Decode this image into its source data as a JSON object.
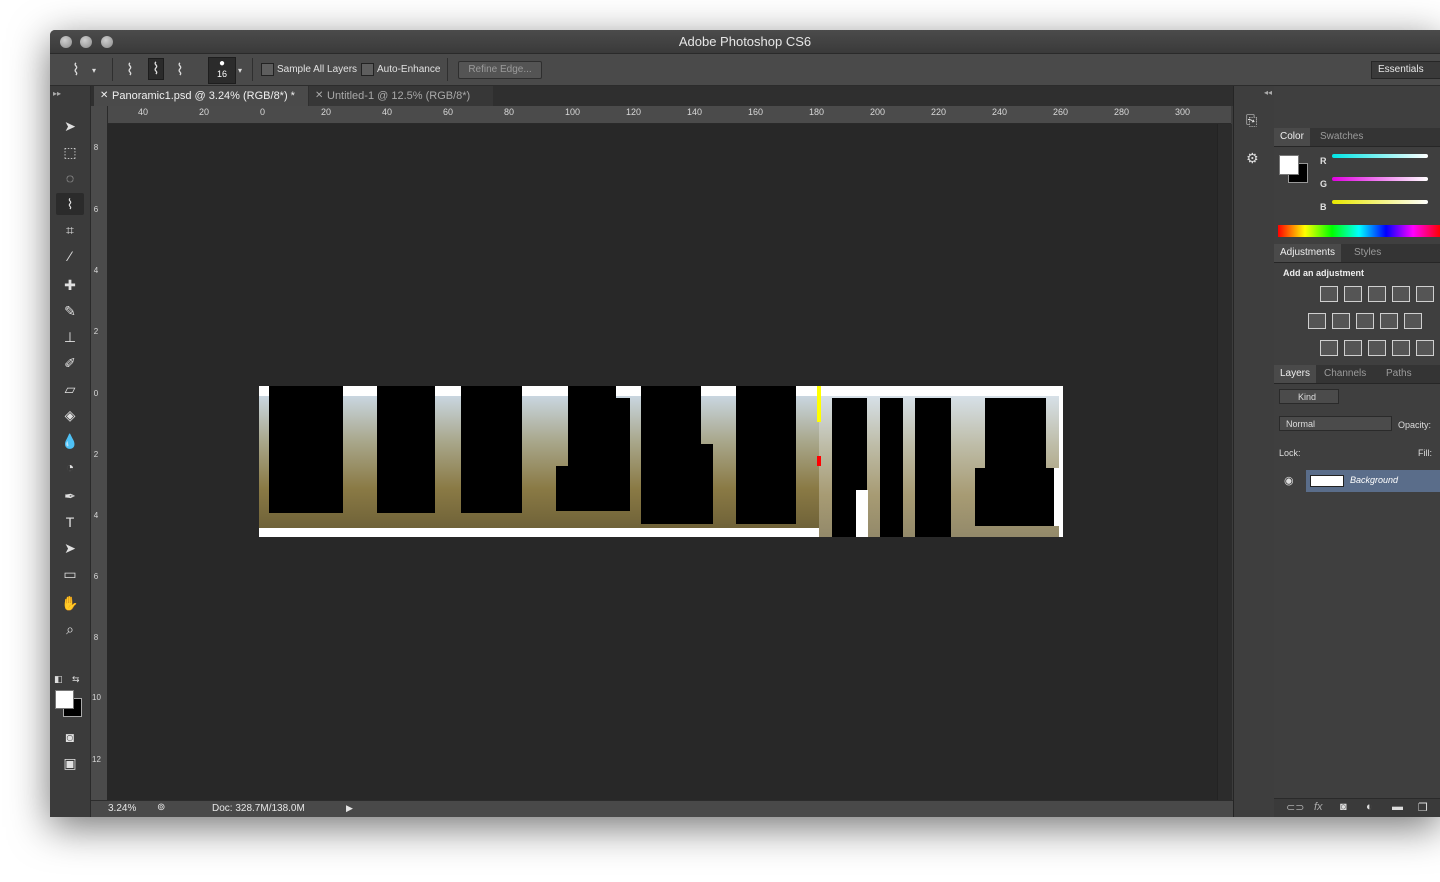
{
  "app": {
    "title": "Adobe Photoshop CS6",
    "workspace": "Essentials"
  },
  "options_bar": {
    "brush_size": "16",
    "sample_all_layers": "Sample All Layers",
    "auto_enhance": "Auto-Enhance",
    "refine_edge": "Refine Edge..."
  },
  "tabs": [
    {
      "label": "Panoramic1.psd @ 3.24% (RGB/8*) *",
      "active": true
    },
    {
      "label": "Untitled-1 @ 12.5% (RGB/8*)",
      "active": false
    }
  ],
  "ruler": {
    "h_labels": [
      "40",
      "20",
      "0",
      "20",
      "40",
      "60",
      "80",
      "100",
      "120",
      "140",
      "160",
      "180",
      "200",
      "220",
      "240",
      "260",
      "280",
      "300"
    ],
    "v_labels": [
      "8",
      "6",
      "4",
      "2",
      "0",
      "2",
      "4",
      "6",
      "8",
      "10",
      "12"
    ]
  },
  "status": {
    "zoom": "3.24%",
    "doc": "Doc: 328.7M/138.0M"
  },
  "color_panel": {
    "tabs": [
      "Color",
      "Swatches"
    ],
    "channels": [
      "R",
      "G",
      "B"
    ],
    "colors": {
      "r": "#00e5e5",
      "g": "#e000e0",
      "b": "#e8e800"
    }
  },
  "adjustments_panel": {
    "tabs": [
      "Adjustments",
      "Styles"
    ],
    "heading": "Add an adjustment"
  },
  "layers_panel": {
    "tabs": [
      "Layers",
      "Channels",
      "Paths"
    ],
    "kind": "Kind",
    "blend_mode": "Normal",
    "opacity_label": "Opacity:",
    "lock_label": "Lock:",
    "fill_label": "Fill:",
    "layers": [
      {
        "name": "Background",
        "selected": true
      }
    ]
  }
}
